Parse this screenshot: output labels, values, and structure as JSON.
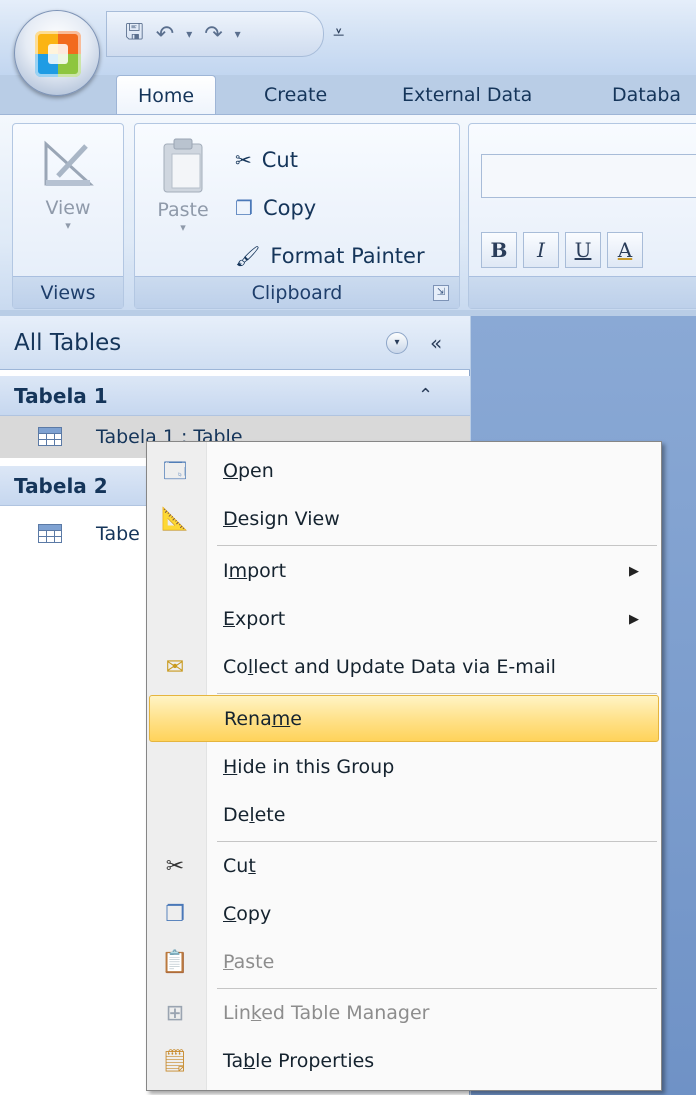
{
  "tabs": [
    "Home",
    "Create",
    "External Data",
    "Databa"
  ],
  "views_group": {
    "view_label": "View",
    "group_label": "Views"
  },
  "clipboard_group": {
    "paste_label": "Paste",
    "cut_label": "Cut",
    "copy_label": "Copy",
    "format_painter_label": "Format Painter",
    "group_label": "Clipboard"
  },
  "font_group": {
    "bold": "B",
    "italic": "I",
    "underline": "U",
    "font_color": "A"
  },
  "nav_pane": {
    "title": "All Tables",
    "groups": [
      {
        "name": "Tabela 1",
        "items": [
          "Tabela 1 : Table"
        ]
      },
      {
        "name": "Tabela 2",
        "items": [
          "Tabe"
        ]
      }
    ]
  },
  "context_menu": {
    "items": [
      {
        "pre": "",
        "u": "O",
        "post": "pen",
        "icon": "open-icon",
        "state": "normal"
      },
      {
        "pre": "",
        "u": "D",
        "post": "esign View",
        "icon": "design-view-icon",
        "state": "normal"
      },
      {
        "pre": "I",
        "u": "m",
        "post": "port",
        "icon": "",
        "state": "normal",
        "submenu": true
      },
      {
        "pre": "",
        "u": "E",
        "post": "xport",
        "icon": "",
        "state": "normal",
        "submenu": true
      },
      {
        "pre": "Co",
        "u": "l",
        "post": "lect and Update Data via E-mail",
        "icon": "collect-data-icon",
        "state": "normal"
      },
      {
        "pre": "Rena",
        "u": "m",
        "post": "e",
        "icon": "",
        "state": "highlighted"
      },
      {
        "pre": "",
        "u": "H",
        "post": "ide in this Group",
        "icon": "",
        "state": "normal"
      },
      {
        "pre": "De",
        "u": "l",
        "post": "ete",
        "icon": "",
        "state": "normal"
      },
      {
        "pre": "Cu",
        "u": "t",
        "post": "",
        "icon": "cut-icon",
        "state": "normal"
      },
      {
        "pre": "",
        "u": "C",
        "post": "opy",
        "icon": "copy-icon",
        "state": "normal"
      },
      {
        "pre": "",
        "u": "P",
        "post": "aste",
        "icon": "paste-icon",
        "state": "disabled"
      },
      {
        "pre": "Lin",
        "u": "k",
        "post": "ed Table Manager",
        "icon": "linked-table-manager-icon",
        "state": "disabled"
      },
      {
        "pre": "Ta",
        "u": "b",
        "post": "le Properties",
        "icon": "table-properties-icon",
        "state": "normal"
      }
    ]
  }
}
